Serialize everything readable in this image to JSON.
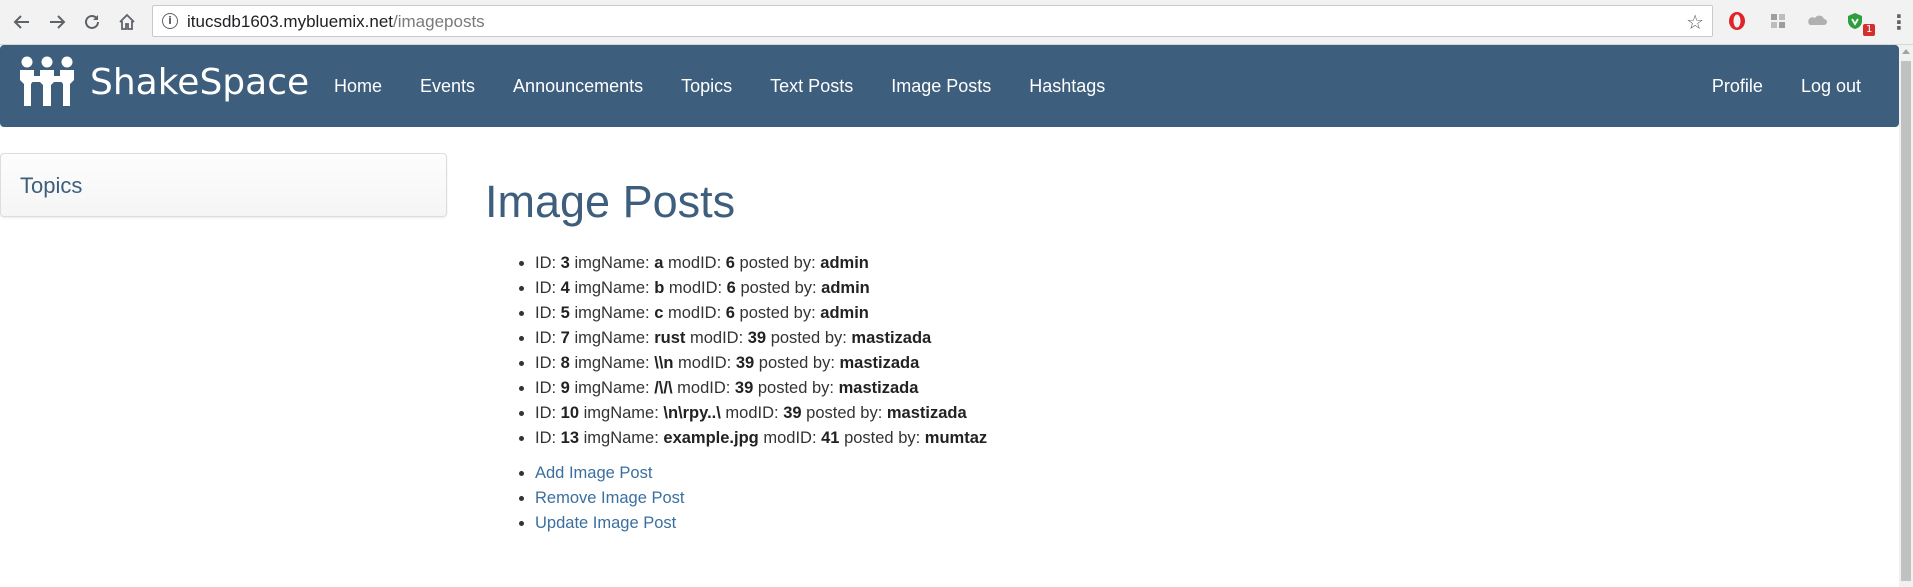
{
  "browser": {
    "url_host": "itucsdb1603.mybluemix.net",
    "url_path": "/imageposts",
    "extension_badge": "1",
    "icons": [
      "back-icon",
      "forward-icon",
      "reload-icon",
      "home-icon",
      "info-icon",
      "star-icon",
      "opera-icon",
      "puzzle-icon",
      "drive-icon",
      "shield-icon",
      "menu-dots-icon"
    ]
  },
  "navbar": {
    "brand": "ShakeSpace",
    "links": [
      "Home",
      "Events",
      "Announcements",
      "Topics",
      "Text Posts",
      "Image Posts",
      "Hashtags"
    ],
    "right_links": [
      "Profile",
      "Log out"
    ],
    "background_color": "#3d5e7c"
  },
  "sidebar": {
    "title": "Topics"
  },
  "main": {
    "title": "Image Posts",
    "labels": {
      "id": "ID: ",
      "img_name": " imgName: ",
      "mod_id": " modID: ",
      "posted_by": " posted by: "
    },
    "posts": [
      {
        "id": "3",
        "imgName": "a",
        "modID": "6",
        "postedBy": "admin"
      },
      {
        "id": "4",
        "imgName": "b",
        "modID": "6",
        "postedBy": "admin"
      },
      {
        "id": "5",
        "imgName": "c",
        "modID": "6",
        "postedBy": "admin"
      },
      {
        "id": "7",
        "imgName": "rust",
        "modID": "39",
        "postedBy": "mastizada"
      },
      {
        "id": "8",
        "imgName": "\\\\n",
        "modID": "39",
        "postedBy": "mastizada"
      },
      {
        "id": "9",
        "imgName": "/\\/\\",
        "modID": "39",
        "postedBy": "mastizada"
      },
      {
        "id": "10",
        "imgName": "\\n\\rpy..\\",
        "modID": "39",
        "postedBy": "mastizada"
      },
      {
        "id": "13",
        "imgName": "example.jpg",
        "modID": "41",
        "postedBy": "mumtaz"
      }
    ],
    "actions": [
      "Add Image Post",
      "Remove Image Post",
      "Update Image Post"
    ]
  }
}
